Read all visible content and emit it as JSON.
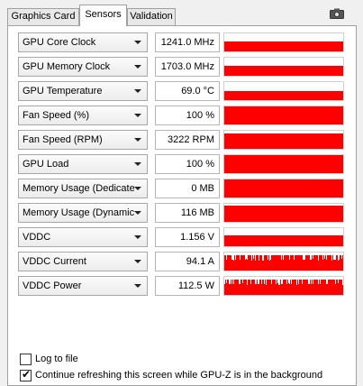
{
  "tabs": [
    {
      "label": "Graphics Card",
      "active": false
    },
    {
      "label": "Sensors",
      "active": true
    },
    {
      "label": "Validation",
      "active": false
    }
  ],
  "camera_icon": "camera-icon",
  "sensors": [
    {
      "name": "GPU Core Clock",
      "value": "1241.0 MHz",
      "fill": 0.55,
      "profile": "flat"
    },
    {
      "name": "GPU Memory Clock",
      "value": "1703.0 MHz",
      "fill": 0.55,
      "profile": "flat"
    },
    {
      "name": "GPU Temperature",
      "value": "69.0 °C",
      "fill": 0.52,
      "profile": "flat"
    },
    {
      "name": "Fan Speed (%)",
      "value": "100 %",
      "fill": 1.0,
      "profile": "full"
    },
    {
      "name": "Fan Speed (RPM)",
      "value": "3222 RPM",
      "fill": 0.85,
      "profile": "flat"
    },
    {
      "name": "GPU Load",
      "value": "100 %",
      "fill": 1.0,
      "profile": "full"
    },
    {
      "name": "Memory Usage (Dedicated)",
      "value": "0 MB",
      "fill": 1.0,
      "profile": "full"
    },
    {
      "name": "Memory Usage (Dynamic)",
      "value": "116 MB",
      "fill": 0.92,
      "profile": "flat"
    },
    {
      "name": "VDDC",
      "value": "1.156 V",
      "fill": 0.6,
      "profile": "flat"
    },
    {
      "name": "VDDC Current",
      "value": "94.1 A",
      "fill": 0.85,
      "profile": "noisy"
    },
    {
      "name": "VDDC Power",
      "value": "112.5 W",
      "fill": 0.85,
      "profile": "noisy"
    }
  ],
  "options": [
    {
      "label": "Log to file",
      "checked": false
    },
    {
      "label": "Continue refreshing this screen while GPU-Z is in the background",
      "checked": true
    }
  ],
  "colors": {
    "graph": "#ff0000",
    "panel": "#ffffff",
    "window": "#f0f0f0"
  }
}
